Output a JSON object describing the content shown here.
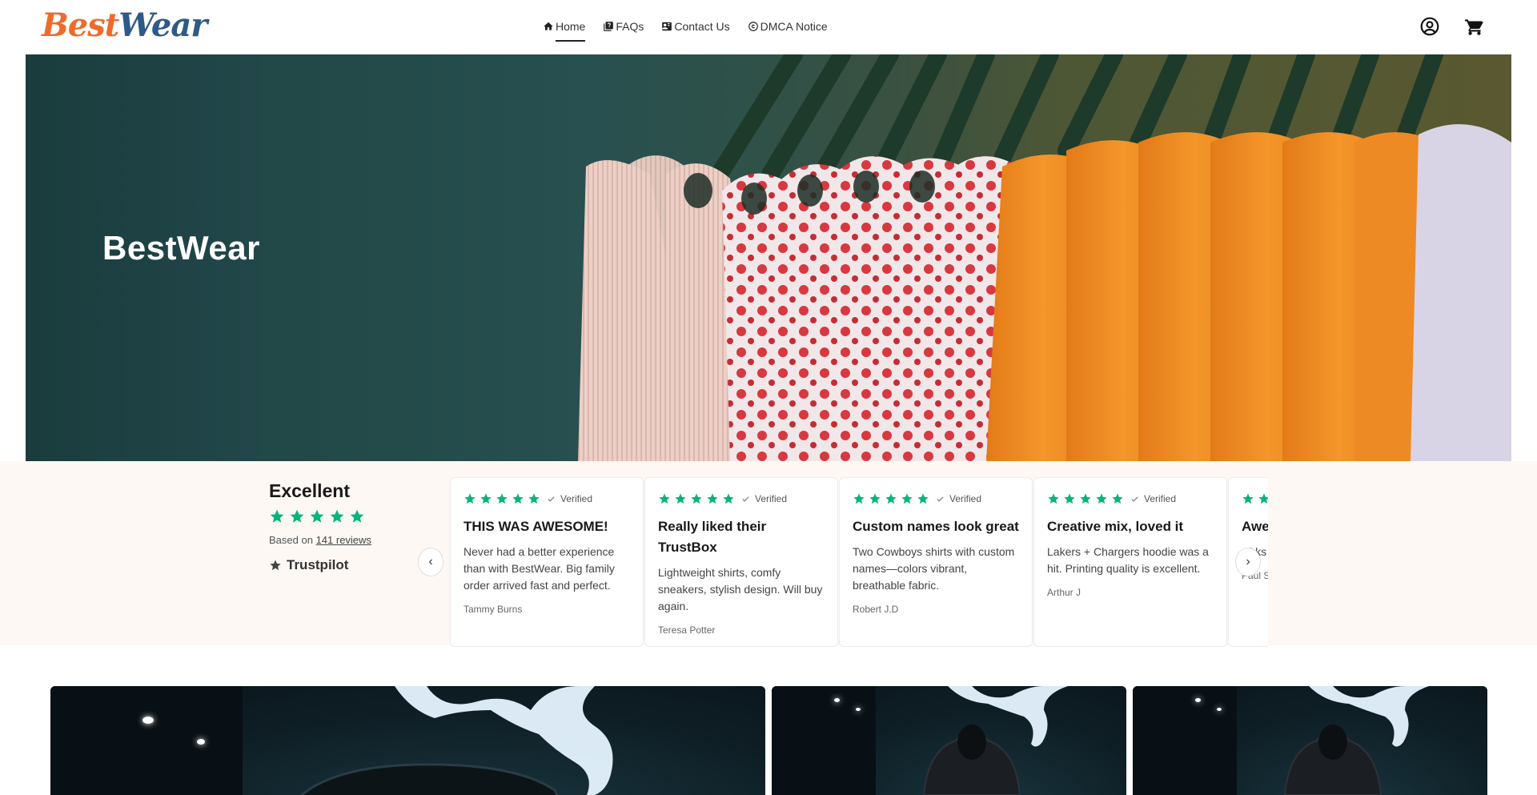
{
  "header": {
    "logo": {
      "part1": "Best",
      "part2": "Wear"
    },
    "nav": [
      {
        "label": "Home",
        "icon": "home-icon",
        "active": true
      },
      {
        "label": "FAQs",
        "icon": "faq-book-icon",
        "active": false
      },
      {
        "label": "Contact Us",
        "icon": "contact-card-icon",
        "active": false
      },
      {
        "label": "DMCA Notice",
        "icon": "copyright-icon",
        "active": false
      }
    ],
    "account_icon": "account-circle-icon",
    "cart_icon": "shopping-cart-icon"
  },
  "hero": {
    "title": "BestWear"
  },
  "reviews": {
    "summary": {
      "rating_word": "Excellent",
      "stars": 5,
      "based_prefix": "Based on",
      "count_link": "141 reviews",
      "brand": "Trustpilot"
    },
    "prev_label": "‹",
    "next_label": "›",
    "cards": [
      {
        "stars": 5,
        "verified": "Verified",
        "title": "THIS WAS AWESOME!",
        "body": "Never had a better experience than with BestWear. Big family order arrived fast and perfect.",
        "author": "Tammy Burns"
      },
      {
        "stars": 5,
        "verified": "Verified",
        "title": "Really liked their TrustBox",
        "body": "Lightweight shirts, comfy sneakers, stylish design. Will buy again.",
        "author": "Teresa Potter"
      },
      {
        "stars": 5,
        "verified": "Verified",
        "title": "Custom names look great",
        "body": "Two Cowboys shirts with custom names—colors vibrant, breathable fabric.",
        "author": "Robert J.D"
      },
      {
        "stars": 5,
        "verified": "Verified",
        "title": "Creative mix, loved it",
        "body": "Lakers + Chargers hoodie was a hit. Printing quality is excellent.",
        "author": "Arthur J"
      },
      {
        "stars": 5,
        "verified": "Verified",
        "title": "Awe",
        "body": "wi ks top-r",
        "author": "Paul S"
      }
    ]
  },
  "colors": {
    "accent_orange": "#ee6c2b",
    "accent_blue": "#2d5a86",
    "trustpilot_green": "#00b67a",
    "reviews_bg": "#fdf8f4"
  }
}
